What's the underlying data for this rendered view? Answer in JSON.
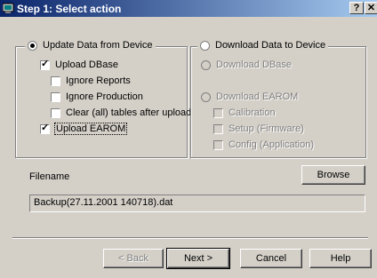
{
  "window": {
    "title": "Step 1: Select action",
    "help_btn": "?",
    "close_btn": "✕"
  },
  "upload_group": {
    "title": "Update Data from Device",
    "upload_dbase": "Upload DBase",
    "ignore_reports": "Ignore Reports",
    "ignore_production": "Ignore Production",
    "clear_tables": "Clear (all) tables after upload",
    "upload_earom": "Upload EAROM"
  },
  "download_group": {
    "title": "Download Data to Device",
    "download_dbase": "Download DBase",
    "download_earom": "Download EAROM",
    "calibration": "Calibration",
    "setup": "Setup (Firmware)",
    "config": "Config (Application)"
  },
  "file": {
    "label": "Filename",
    "browse": "Browse",
    "value": "Backup(27.11.2001 140718).dat"
  },
  "buttons": {
    "back": "< Back",
    "next": "Next >",
    "cancel": "Cancel",
    "help": "Help"
  }
}
